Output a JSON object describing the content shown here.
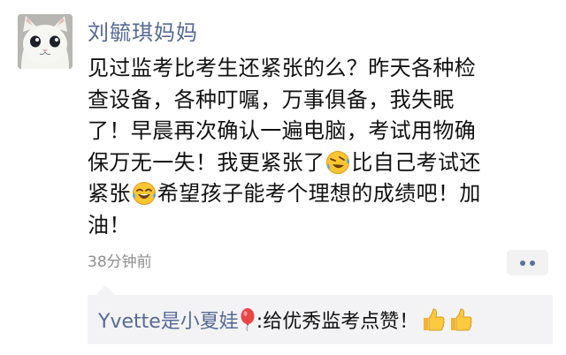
{
  "post": {
    "author": "刘毓琪妈妈",
    "lines": [
      {
        "a": "见过监考比考生还紧张的么？昨天各种检"
      },
      {
        "a": "查设备，各种叮嘱，万事俱备，我失眠"
      },
      {
        "a": "了！早晨再次确认一遍电脑，考试用物确"
      },
      {
        "a": "保万无一失！我更紧张了",
        "b": "比自己考试还"
      },
      {
        "a": "紧张",
        "b": "希望孩子能考个理想的成绩吧！加"
      },
      {
        "a": "油！"
      }
    ],
    "time": "38分钟前"
  },
  "comment": {
    "user": "Yvette是小夏娃",
    "text": ":给优秀监考点赞！"
  },
  "icons": {
    "avatar": "cat-avatar",
    "emoji_1": "tears-of-joy-tilted-emoji",
    "emoji_2": "tears-of-joy-emoji",
    "balloon": "red-balloon-emoji",
    "thumbs": "thumbs-up-emoji",
    "more": "more-dots-icon"
  },
  "colors": {
    "link": "#566a94",
    "text": "#111111",
    "meta": "#8f8f8f",
    "comment_bg": "#f3f3f5"
  }
}
